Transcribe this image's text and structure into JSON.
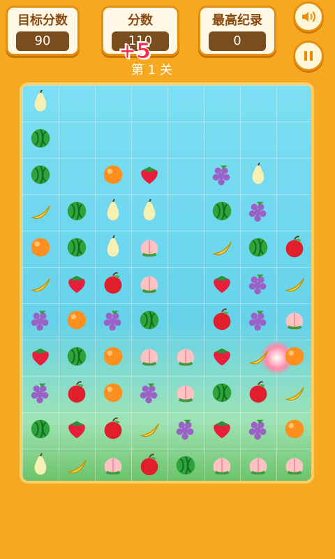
{
  "hud": {
    "target_label": "目标分数",
    "target_value": "90",
    "score_label": "分数",
    "score_value": "110",
    "best_label": "最高纪录",
    "best_value": "0",
    "plus_popup": "+5",
    "level_text": "第 1 关"
  },
  "colors": {
    "background": "#f7a821",
    "panel_border": "#e58d10"
  },
  "icons": {
    "sound": "speaker-icon",
    "pause": "pause-icon"
  },
  "board": {
    "rows": [
      [
        "pear",
        null,
        null,
        null,
        null,
        null,
        null,
        null
      ],
      [
        "watermelon",
        null,
        null,
        null,
        null,
        null,
        null,
        null
      ],
      [
        "watermelon",
        null,
        "orange",
        "strawberry",
        null,
        "grape",
        "pear",
        null
      ],
      [
        "banana",
        "watermelon",
        "pear",
        "pear",
        null,
        "watermelon",
        "grape",
        null
      ],
      [
        "orange",
        "watermelon",
        "pear",
        "peach",
        null,
        "banana",
        "watermelon",
        "apple"
      ],
      [
        "banana",
        "strawberry",
        "apple",
        "peach",
        null,
        "strawberry",
        "grape",
        "banana"
      ],
      [
        "grape",
        "orange",
        "grape",
        "watermelon",
        null,
        "apple",
        "grape",
        "peach"
      ],
      [
        "strawberry",
        "watermelon",
        "orange",
        "peach",
        "peach",
        "strawberry",
        "banana",
        "orange"
      ],
      [
        "grape",
        "apple",
        "orange",
        "grape",
        "peach",
        "watermelon",
        "apple",
        "banana"
      ],
      [
        "watermelon",
        "strawberry",
        "apple",
        "banana",
        "grape",
        "strawberry",
        "grape",
        "orange"
      ],
      [
        "pear",
        "banana",
        "peach",
        "apple",
        "watermelon",
        "peach",
        "peach",
        "peach"
      ]
    ]
  }
}
